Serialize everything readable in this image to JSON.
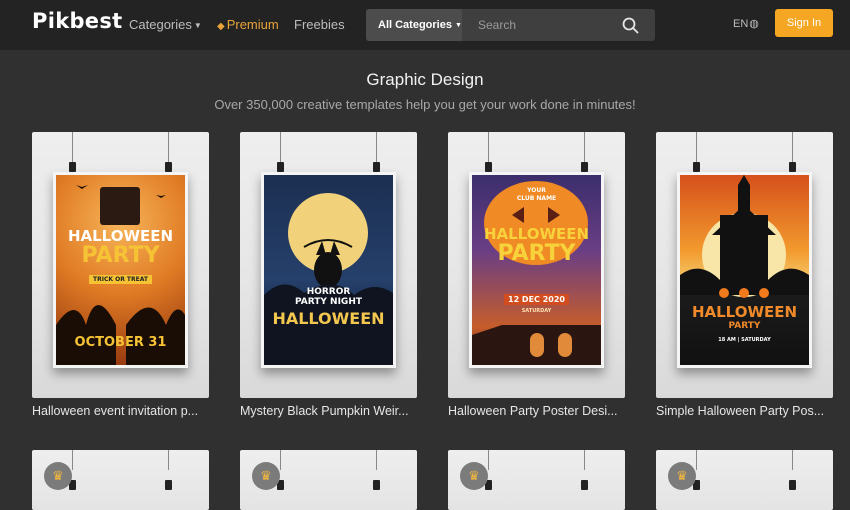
{
  "nav": {
    "logo": "Pikbest",
    "categories": "Categories",
    "premium": "Premium",
    "freebies": "Freebies",
    "search_category": "All Categories",
    "search_placeholder": "Search",
    "language": "EN",
    "sign_in": "Sign In"
  },
  "page": {
    "title": "Graphic Design",
    "subtitle": "Over 350,000 creative templates help you get your work done in minutes!"
  },
  "cards": [
    {
      "title": "Halloween event invitation p...",
      "poster": {
        "l1": "HALLOWEEN",
        "l2": "PARTY",
        "l3": "TRICK OR TREAT",
        "l4": "OCTOBER 31"
      }
    },
    {
      "title": "Mystery Black Pumpkin Weir...",
      "poster": {
        "l1": "HORROR",
        "l2": "PARTY NIGHT",
        "l3": "HALLOWEEN"
      }
    },
    {
      "title": "Halloween Party Poster Desi...",
      "poster": {
        "l1": "YOUR",
        "l2": "CLUB NAME",
        "l3": "HALLOWEEN",
        "l4": "PARTY",
        "l5": "12 DEC 2020",
        "l6": "SATURDAY"
      }
    },
    {
      "title": "Simple Halloween Party Pos...",
      "poster": {
        "l1": "HALLOWEEN",
        "l2": "PARTY",
        "l3": "18 AM | SATURDAY"
      }
    }
  ],
  "colors": {
    "accent": "#f5a623",
    "premium": "#e8a33a",
    "background": "#303030",
    "nav": "#232323"
  },
  "icons": {
    "search": "search-icon",
    "globe": "globe-icon",
    "crown": "crown-icon",
    "premium": "diamond-icon"
  }
}
